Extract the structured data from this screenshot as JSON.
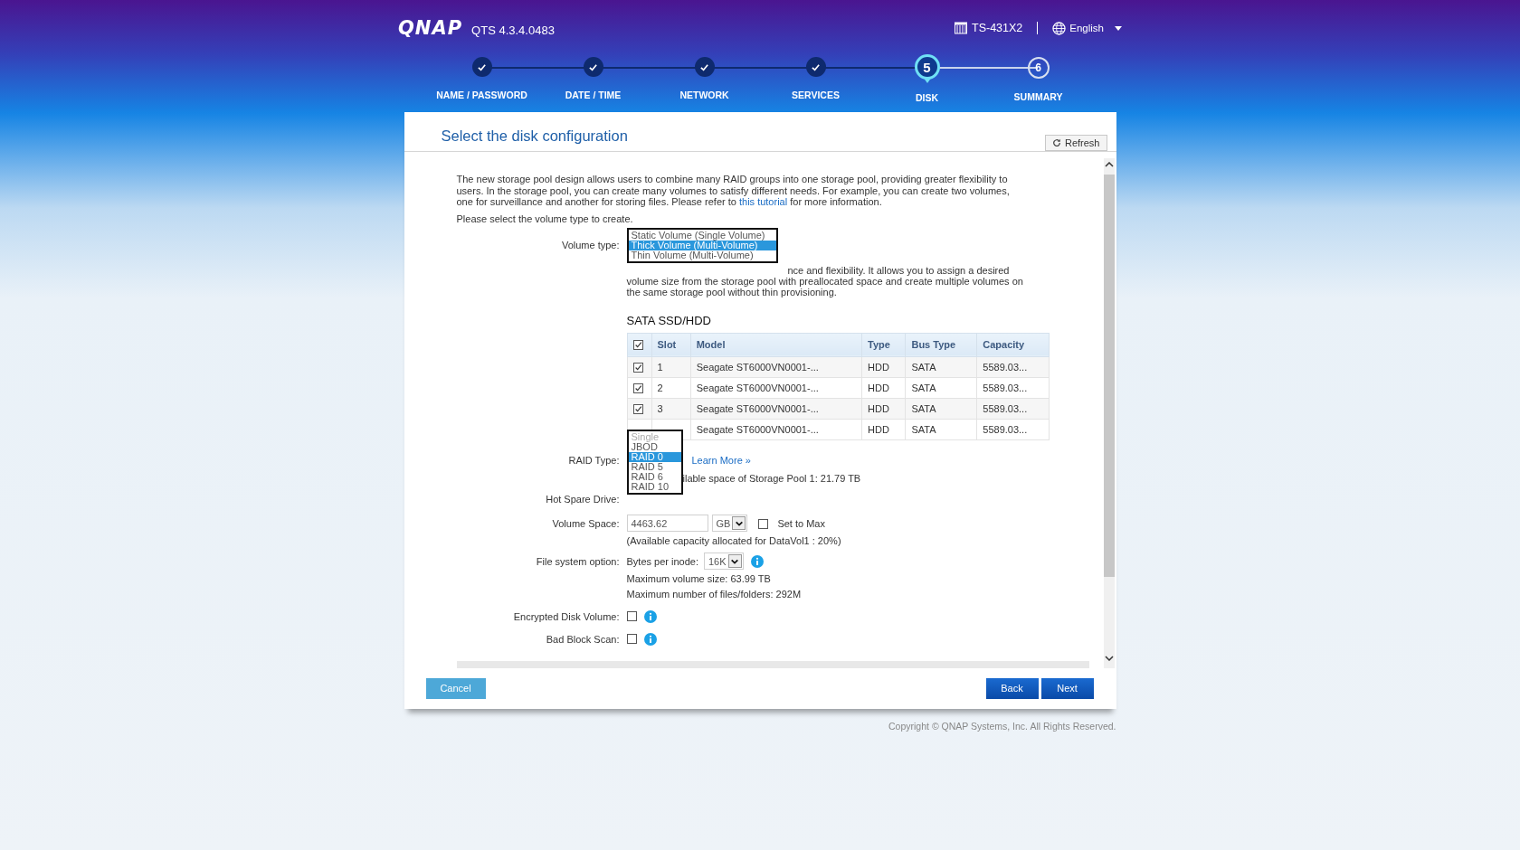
{
  "header": {
    "logo": "QNAP",
    "version": "QTS 4.3.4.0483",
    "device": "TS-431X2",
    "language": "English"
  },
  "steps": [
    {
      "label": "NAME / PASSWORD",
      "completed": true,
      "selected": false
    },
    {
      "label": "DATE / TIME",
      "completed": true,
      "selected": false
    },
    {
      "label": "NETWORK",
      "completed": true,
      "selected": false
    },
    {
      "label": "SERVICES",
      "completed": true,
      "selected": false
    },
    {
      "label": "DISK",
      "number": "5",
      "completed": false,
      "selected": true
    },
    {
      "label": "SUMMARY",
      "number": "6",
      "completed": false,
      "selected": false
    }
  ],
  "page": {
    "title": "Select the disk configuration",
    "refresh_button": "Refresh"
  },
  "intro": {
    "text_before": "The new storage pool design allows users to combine many RAID groups into one storage pool, providing greater flexibility to users. In the storage pool, you can create many volumes to satisfy different needs. For example, you can create two volumes, one for surveillance and another for storing files. Please refer to ",
    "link": "this tutorial",
    "text_after": " for more information."
  },
  "prompt": "Please select the volume type to create.",
  "volume_type": {
    "label": "Volume type:",
    "options": [
      {
        "label": "Static Volume (Single Volume)",
        "selected": false
      },
      {
        "label": "Thick Volume (Multi-Volume)",
        "selected": true
      },
      {
        "label": "Thin Volume (Multi-Volume)",
        "selected": false
      }
    ],
    "description": "nce and flexibility. It allows you to assign a desired volume size from the storage pool with preallocated space and create multiple volumes on the same storage pool without thin provisioning."
  },
  "disks": {
    "title": "SATA SSD/HDD",
    "all_checked": true,
    "columns": [
      "Slot",
      "Model",
      "Type",
      "Bus Type",
      "Capacity"
    ],
    "rows": [
      {
        "checked": true,
        "slot": "1",
        "model": "Seagate ST6000VN0001-...",
        "type": "HDD",
        "bus_type": "SATA",
        "capacity": "5589.03..."
      },
      {
        "checked": true,
        "slot": "2",
        "model": "Seagate ST6000VN0001-...",
        "type": "HDD",
        "bus_type": "SATA",
        "capacity": "5589.03..."
      },
      {
        "checked": true,
        "slot": "3",
        "model": "Seagate ST6000VN0001-...",
        "type": "HDD",
        "bus_type": "SATA",
        "capacity": "5589.03..."
      },
      {
        "model": "Seagate ST6000VN0001-...",
        "type": "HDD",
        "bus_type": "SATA",
        "capacity": "5589.03..."
      }
    ]
  },
  "raid_type": {
    "label": "RAID Type:",
    "options": [
      {
        "label": "Single",
        "selected": false,
        "disabled": true
      },
      {
        "label": "JBOD",
        "selected": false,
        "disabled": false
      },
      {
        "label": "RAID 0",
        "selected": true,
        "disabled": false
      },
      {
        "label": "RAID 5",
        "selected": false,
        "disabled": false
      },
      {
        "label": "RAID 6",
        "selected": false,
        "disabled": false
      },
      {
        "label": "RAID 10",
        "selected": false,
        "disabled": false
      }
    ],
    "learn_more": "Learn More »",
    "available_space": "ilable space of Storage Pool 1: 21.79 TB"
  },
  "hot_spare": {
    "label": "Hot Spare Drive:"
  },
  "volume_space": {
    "label": "Volume Space:",
    "value": "4463.62",
    "unit": "GB",
    "set_to_max": {
      "label": "Set to Max",
      "checked": false
    },
    "note": "(Available capacity allocated for DataVol1 : 20%)"
  },
  "file_system": {
    "label": "File system option:",
    "inode_label": "Bytes per inode:",
    "inode_value": "16K",
    "max_volume": "Maximum volume size: 63.99 TB",
    "max_files": "Maximum number of files/folders: 292M"
  },
  "encryption": {
    "label": "Encrypted Disk Volume:",
    "checked": false
  },
  "bad_block_scan": {
    "label": "Bad Block Scan:",
    "checked": false
  },
  "buttons": {
    "cancel": "Cancel",
    "back": "Back",
    "next": "Next"
  },
  "copyright": "Copyright © QNAP Systems, Inc. All Rights Reserved."
}
